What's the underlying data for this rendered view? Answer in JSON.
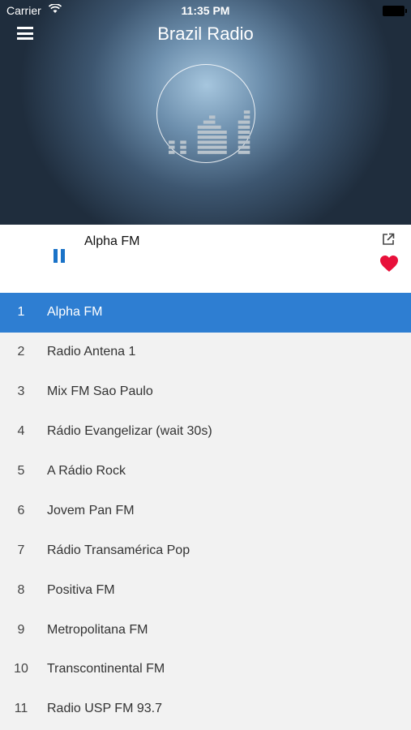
{
  "status_bar": {
    "carrier": "Carrier",
    "time": "11:35 PM"
  },
  "header": {
    "title": "Brazil Radio",
    "menu_icon": "hamburger-menu-icon",
    "logo_icon": "equalizer-icon"
  },
  "player": {
    "now_playing": "Alpha FM",
    "state_icon": "pause-icon",
    "share_icon": "share-icon",
    "favorite_icon": "heart-icon",
    "accent_color": "#1a73c8",
    "favorite_color": "#e8103a"
  },
  "selection_color": "#2e7ed2",
  "stations": [
    {
      "num": "1",
      "name": "Alpha FM"
    },
    {
      "num": "2",
      "name": "Radio Antena 1"
    },
    {
      "num": "3",
      "name": "Mix FM Sao Paulo"
    },
    {
      "num": "4",
      "name": "Rádio Evangelizar (wait 30s)"
    },
    {
      "num": "5",
      "name": "A Rádio Rock"
    },
    {
      "num": "6",
      "name": "Jovem Pan FM"
    },
    {
      "num": "7",
      "name": "Rádio Transamérica Pop"
    },
    {
      "num": "8",
      "name": "Positiva FM"
    },
    {
      "num": "9",
      "name": "Metropolitana FM"
    },
    {
      "num": "10",
      "name": "Transcontinental FM"
    },
    {
      "num": "11",
      "name": "Radio USP FM 93.7"
    }
  ]
}
